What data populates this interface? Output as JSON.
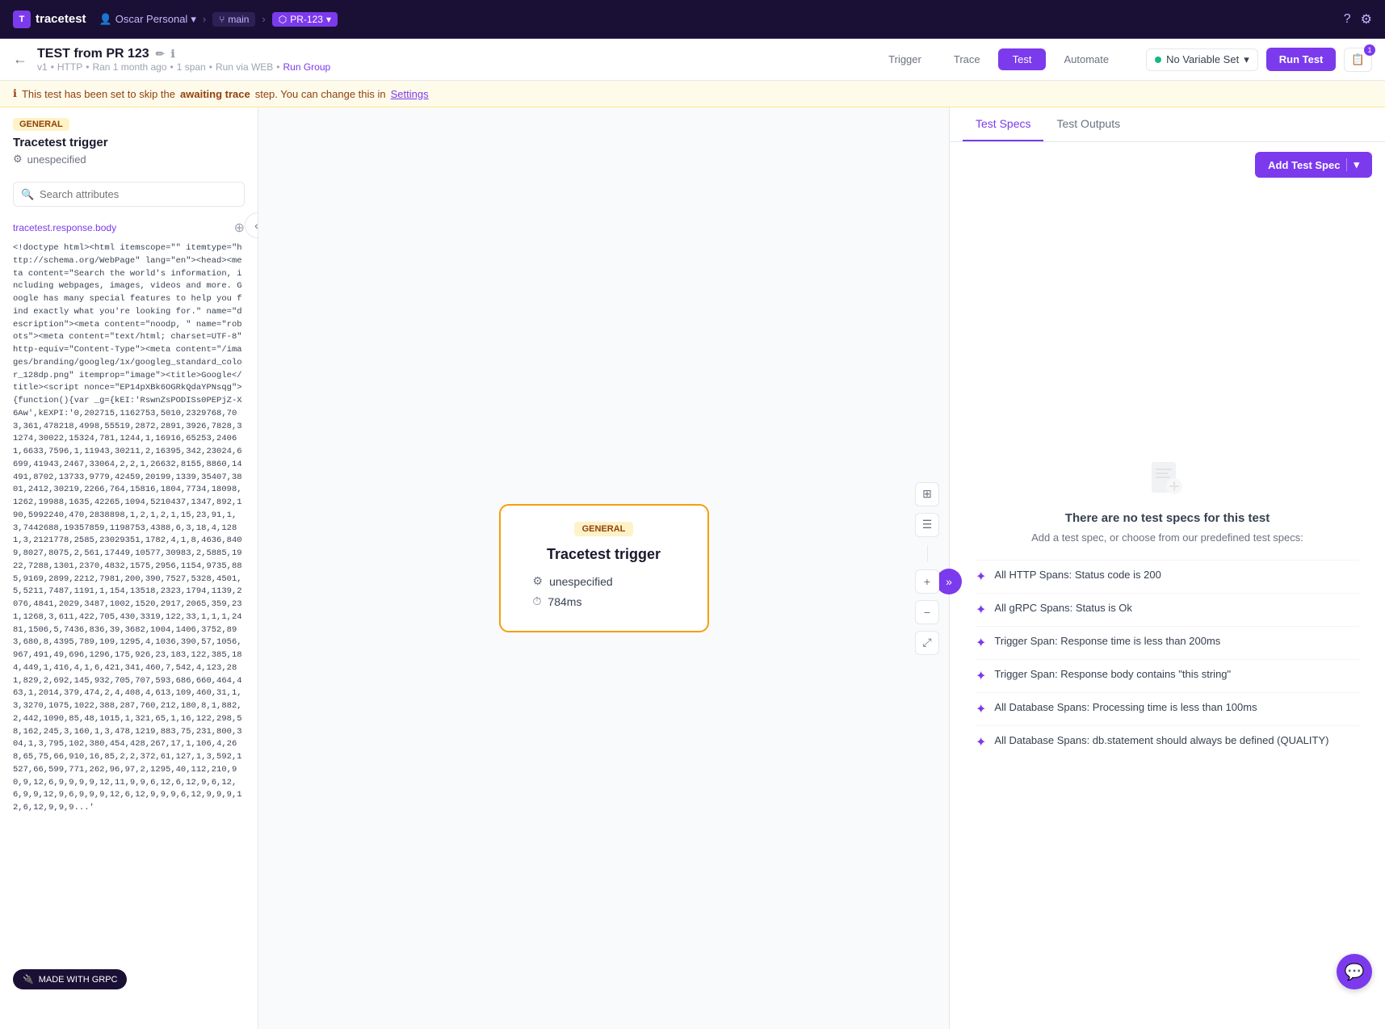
{
  "app": {
    "logo_text": "tracetest",
    "logo_icon": "T"
  },
  "nav": {
    "user": "Oscar Personal",
    "branch_icon": "⑂",
    "branch_name": "main",
    "pr_badge": "PR-123",
    "help_icon": "?",
    "settings_icon": "⚙"
  },
  "test": {
    "title": "TEST from PR 123",
    "version": "v1",
    "protocol": "HTTP",
    "ran": "Ran 1 month ago",
    "spans": "1 span",
    "via": "Run via WEB",
    "run_group": "Run Group"
  },
  "tabs": [
    {
      "id": "trigger",
      "label": "Trigger",
      "active": false
    },
    {
      "id": "trace",
      "label": "Trace",
      "active": false
    },
    {
      "id": "test",
      "label": "Test",
      "active": true
    },
    {
      "id": "automate",
      "label": "Automate",
      "active": false
    }
  ],
  "header_right": {
    "variable_set_label": "No Variable Set",
    "run_test_label": "Run Test",
    "badge_count": "1"
  },
  "info_bar": {
    "icon": "ℹ",
    "text_before": "This test has been set to skip the",
    "highlight": "awaiting trace",
    "text_after": "step. You can change this in",
    "link": "Settings"
  },
  "left_panel": {
    "badge": "GENERAL",
    "title": "Tracetest trigger",
    "sub_icon": "⚙",
    "sub_text": "unespecified",
    "search_placeholder": "Search attributes",
    "attr_label": "tracetest.response.body",
    "code_content": "<!doctype html><html itemscope=\"\" itemtype=\"http://schema.org/WebPage\" lang=\"en\"><head><meta content=\"Search the world's information, including webpages, images, videos and more. Google has many special features to help you find exactly what you're looking for.\" name=\"description\"><meta content=\"noodp, \" name=\"robots\"><meta content=\"text/html; charset=UTF-8\" http-equiv=\"Content-Type\"><meta content=\"/images/branding/googleg/1x/googleg_standard_color_128dp.png\" itemprop=\"image\"><title>Google</title><script nonce=\"EP14pXBk6OGRkQdaYPNsqg\">{function(){var _g={kEI:'RswnZsPODISs0PEPjZ-X6Aw',kEXPI:'0,202715,1162753,5010,2329768,703,361,478218,4998,55519,2872,2891,3926,7828,31274,30022,15324,781,1244,1,16916,65253,24061,6633,7596,1,11943,30211,2,16395,342,23024,6699,41943,2467,33064,2,2,1,26632,8155,8860,14491,8702,13733,9779,42459,20199,1339,35407,3801,2412,30219,2266,764,15816,1804,7734,18098,1262,19988,1635,42265,1094,5210437,1347,892,190,5992240,470,2838898,1,2,1,2,1,15,23,91,1,3,7442688,19357859,1198753,4388,6,3,18,4,1281,3,2121778,2585,23029351,1782,4,1,8,4636,8409,8027,8075,2,561,17449,10577,30983,2,5885,1922,7288,1301,2370,4832,1575,2956,1154,9735,885,9169,2899,2212,7981,200,390,7527,5328,4501,5,5211,7487,1191,1,154,13518,2323,1794,1139,2076,4841,2029,3487,1002,1520,2917,2065,359,231,1268,3,611,422,705,430,3319,122,33,1,1,1,2481,1506,5,7436,836,39,3682,1004,1406,3752,893,680,8,4395,789,109,1295,4,1036,390,57,1056,967,491,49,696,1296,175,926,23,183,122,385,184,449,1,416,4,1,6,421,341,460,7,542,4,123,281,829,2,692,145,932,705,707,593,686,660,464,463,1,2014,379,474,2,4,408,4,613,109,460,31,1,3,3270,1075,1022,388,287,760,212,180,8,1,882,2,442,1090,85,48,1015,1,321,65,1,16,122,298,58,162,245,3,160,1,3,478,1219,883,75,231,800,304,1,3,795,102,380,454,428,267,17,1,106,4,268,65,75,66,910,16,85,2,2,372,61,127,1,3,592,1527,66,599,771,262,96,97,2,1295,40,112,210,90,9,12,6,9,9,9,9,12,11,9,9,6,12,6,12,9,6,12,6,9,9,12,9,6,9,9,9,12,6,12,9,9,9,6,12,9,9,9,12,6,12,9,9,9...'"
  },
  "trace_card": {
    "badge": "GENERAL",
    "title": "Tracetest trigger",
    "row1_icon": "⚙",
    "row1_text": "unespecified",
    "row2_icon": "⏱",
    "row2_text": "784ms"
  },
  "right_panel": {
    "tabs": [
      {
        "id": "test_specs",
        "label": "Test Specs",
        "active": true
      },
      {
        "id": "test_outputs",
        "label": "Test Outputs",
        "active": false
      }
    ],
    "add_spec_label": "Add Test Spec",
    "empty_title": "There are no test specs for this test",
    "empty_desc": "Add a test spec, or choose from our predefined test specs:",
    "suggestions": [
      {
        "id": 1,
        "text": "All HTTP Spans: Status code is 200"
      },
      {
        "id": 2,
        "text": "All gRPC Spans: Status is Ok"
      },
      {
        "id": 3,
        "text": "Trigger Span: Response time is less than 200ms"
      },
      {
        "id": 4,
        "text": "Trigger Span: Response body contains \"this string\""
      },
      {
        "id": 5,
        "text": "All Database Spans: Processing time is less than 100ms"
      },
      {
        "id": 6,
        "text": "All Database Spans: db.statement should always be defined (QUALITY)"
      }
    ]
  },
  "footer": {
    "made_with": "MADE WITH GRPC"
  }
}
